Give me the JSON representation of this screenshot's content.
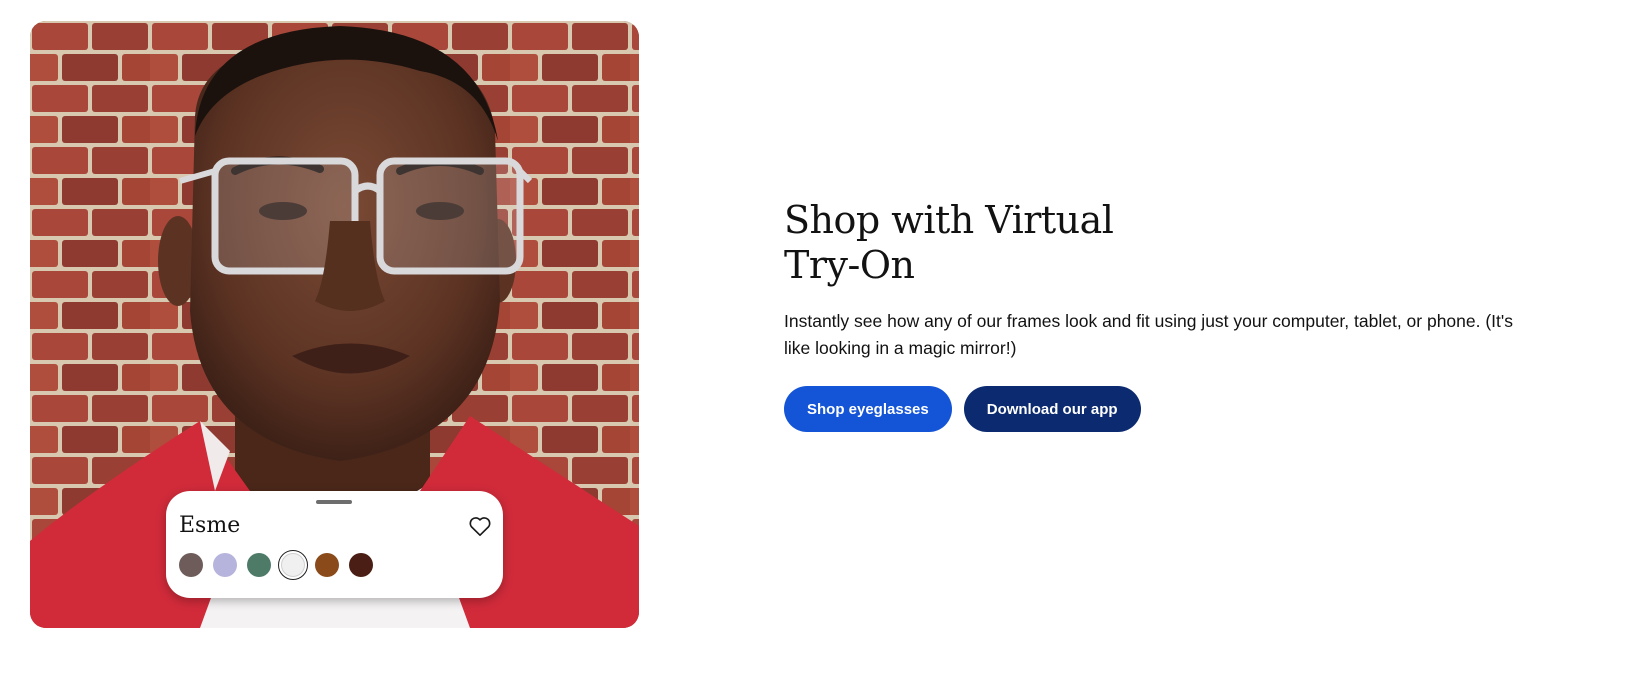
{
  "promo": {
    "heading": "Shop with Virtual Try-On",
    "description": "Instantly see how any of our frames look and fit using just your computer, tablet, or phone. (It's like looking in a magic mirror!)",
    "shop_button_label": "Shop eyeglasses",
    "app_button_label": "Download our app"
  },
  "tryon": {
    "frame_name": "Esme",
    "favorite_icon": "heart-icon",
    "swatches": [
      {
        "name": "tortoise-grey",
        "color": "#6e5c5a"
      },
      {
        "name": "lavender-crystal",
        "color": "#b6b3dc"
      },
      {
        "name": "sage-green",
        "color": "#4e7a68"
      },
      {
        "name": "clear-crystal",
        "color": "#f1f0f0",
        "selected": true
      },
      {
        "name": "amber-tortoise",
        "color": "#8a4a1a"
      },
      {
        "name": "dark-tortoise",
        "color": "#4a1e14"
      }
    ]
  },
  "colors": {
    "primary_button": "#1454d6",
    "secondary_button": "#0b2a6f",
    "text": "#121212"
  }
}
